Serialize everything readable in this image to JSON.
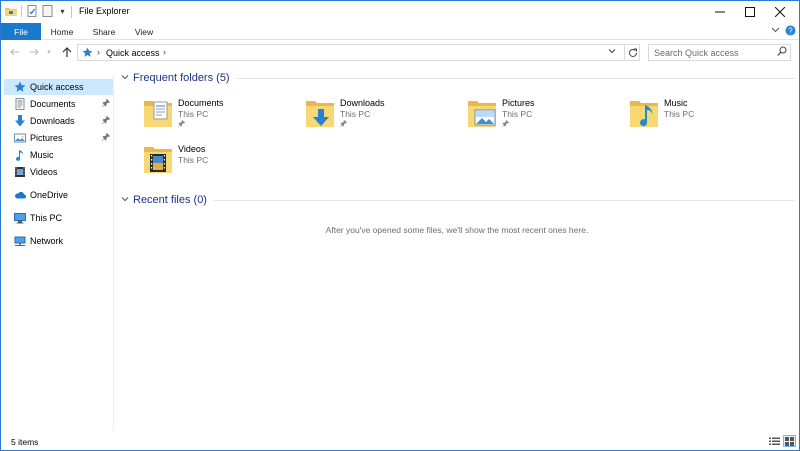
{
  "window": {
    "title": "File Explorer",
    "controls": {
      "minimize": "—",
      "maximize": "☐",
      "close": "✕"
    }
  },
  "ribbon": {
    "tabs": [
      {
        "label": "File"
      },
      {
        "label": "Home"
      },
      {
        "label": "Share"
      },
      {
        "label": "View"
      }
    ],
    "file_tab_color": "#1979ca"
  },
  "address": {
    "crumb": "Quick access",
    "search_placeholder": "Search Quick access"
  },
  "nav": {
    "items": [
      {
        "label": "Quick access",
        "icon": "star-icon"
      },
      {
        "label": "Documents",
        "icon": "documents-folder-icon",
        "pinned": true
      },
      {
        "label": "Downloads",
        "icon": "download-arrow-icon",
        "pinned": true
      },
      {
        "label": "Pictures",
        "icon": "pictures-folder-icon",
        "pinned": true
      },
      {
        "label": "Music",
        "icon": "music-note-icon"
      },
      {
        "label": "Videos",
        "icon": "videos-folder-icon"
      },
      {
        "label": "OneDrive",
        "icon": "cloud-icon"
      },
      {
        "label": "This PC",
        "icon": "monitor-icon"
      },
      {
        "label": "Network",
        "icon": "network-icon"
      }
    ]
  },
  "content": {
    "frequent": {
      "title": "Frequent folders (5)",
      "folders": [
        {
          "name": "Documents",
          "location": "This PC",
          "pinned": true
        },
        {
          "name": "Downloads",
          "location": "This PC",
          "pinned": true
        },
        {
          "name": "Pictures",
          "location": "This PC",
          "pinned": true
        },
        {
          "name": "Music",
          "location": "This PC",
          "pinned": false
        },
        {
          "name": "Videos",
          "location": "This PC",
          "pinned": false
        }
      ]
    },
    "recent": {
      "title": "Recent files (0)",
      "empty_message": "After you've opened some files, we'll show the most recent ones here."
    }
  },
  "status": {
    "items_text": "5 items"
  },
  "colors": {
    "accent": "#1979ca",
    "group_title": "#1e3287",
    "selection": "#cce8ff",
    "folder_yellow": "#f8d775"
  }
}
